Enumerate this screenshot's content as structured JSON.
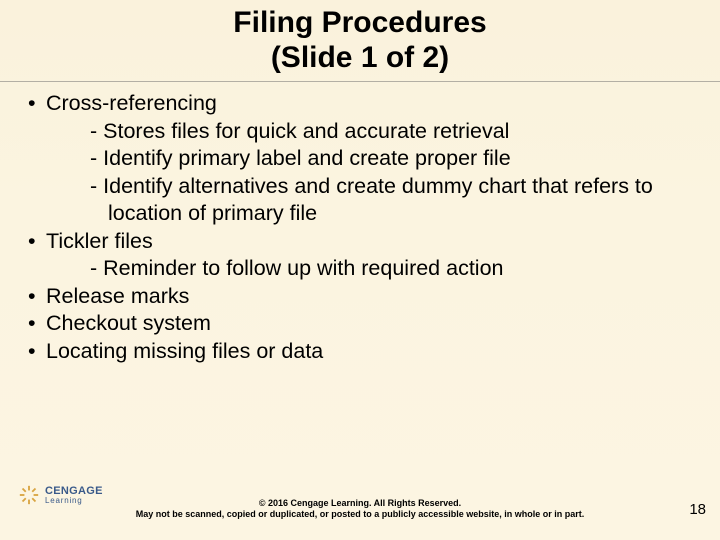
{
  "title": "Filing Procedures\n(Slide 1 of 2)",
  "bullets": [
    {
      "label": "Cross-referencing",
      "subs": [
        "Stores files for quick and accurate retrieval",
        "Identify primary label and create proper file",
        "Identify alternatives and create dummy chart that refers to location of primary file"
      ]
    },
    {
      "label": "Tickler files",
      "subs": [
        "Reminder to follow up with required action"
      ]
    },
    {
      "label": "Release marks",
      "subs": []
    },
    {
      "label": "Checkout system",
      "subs": []
    },
    {
      "label": "Locating missing files or data",
      "subs": []
    }
  ],
  "copyright": {
    "line1": "© 2016 Cengage Learning. All Rights Reserved.",
    "line2": "May not be scanned, copied or duplicated, or posted to a publicly accessible website, in whole or in part."
  },
  "logo": {
    "brand": "CENGAGE",
    "sub": "Learning"
  },
  "slide_number": "18"
}
